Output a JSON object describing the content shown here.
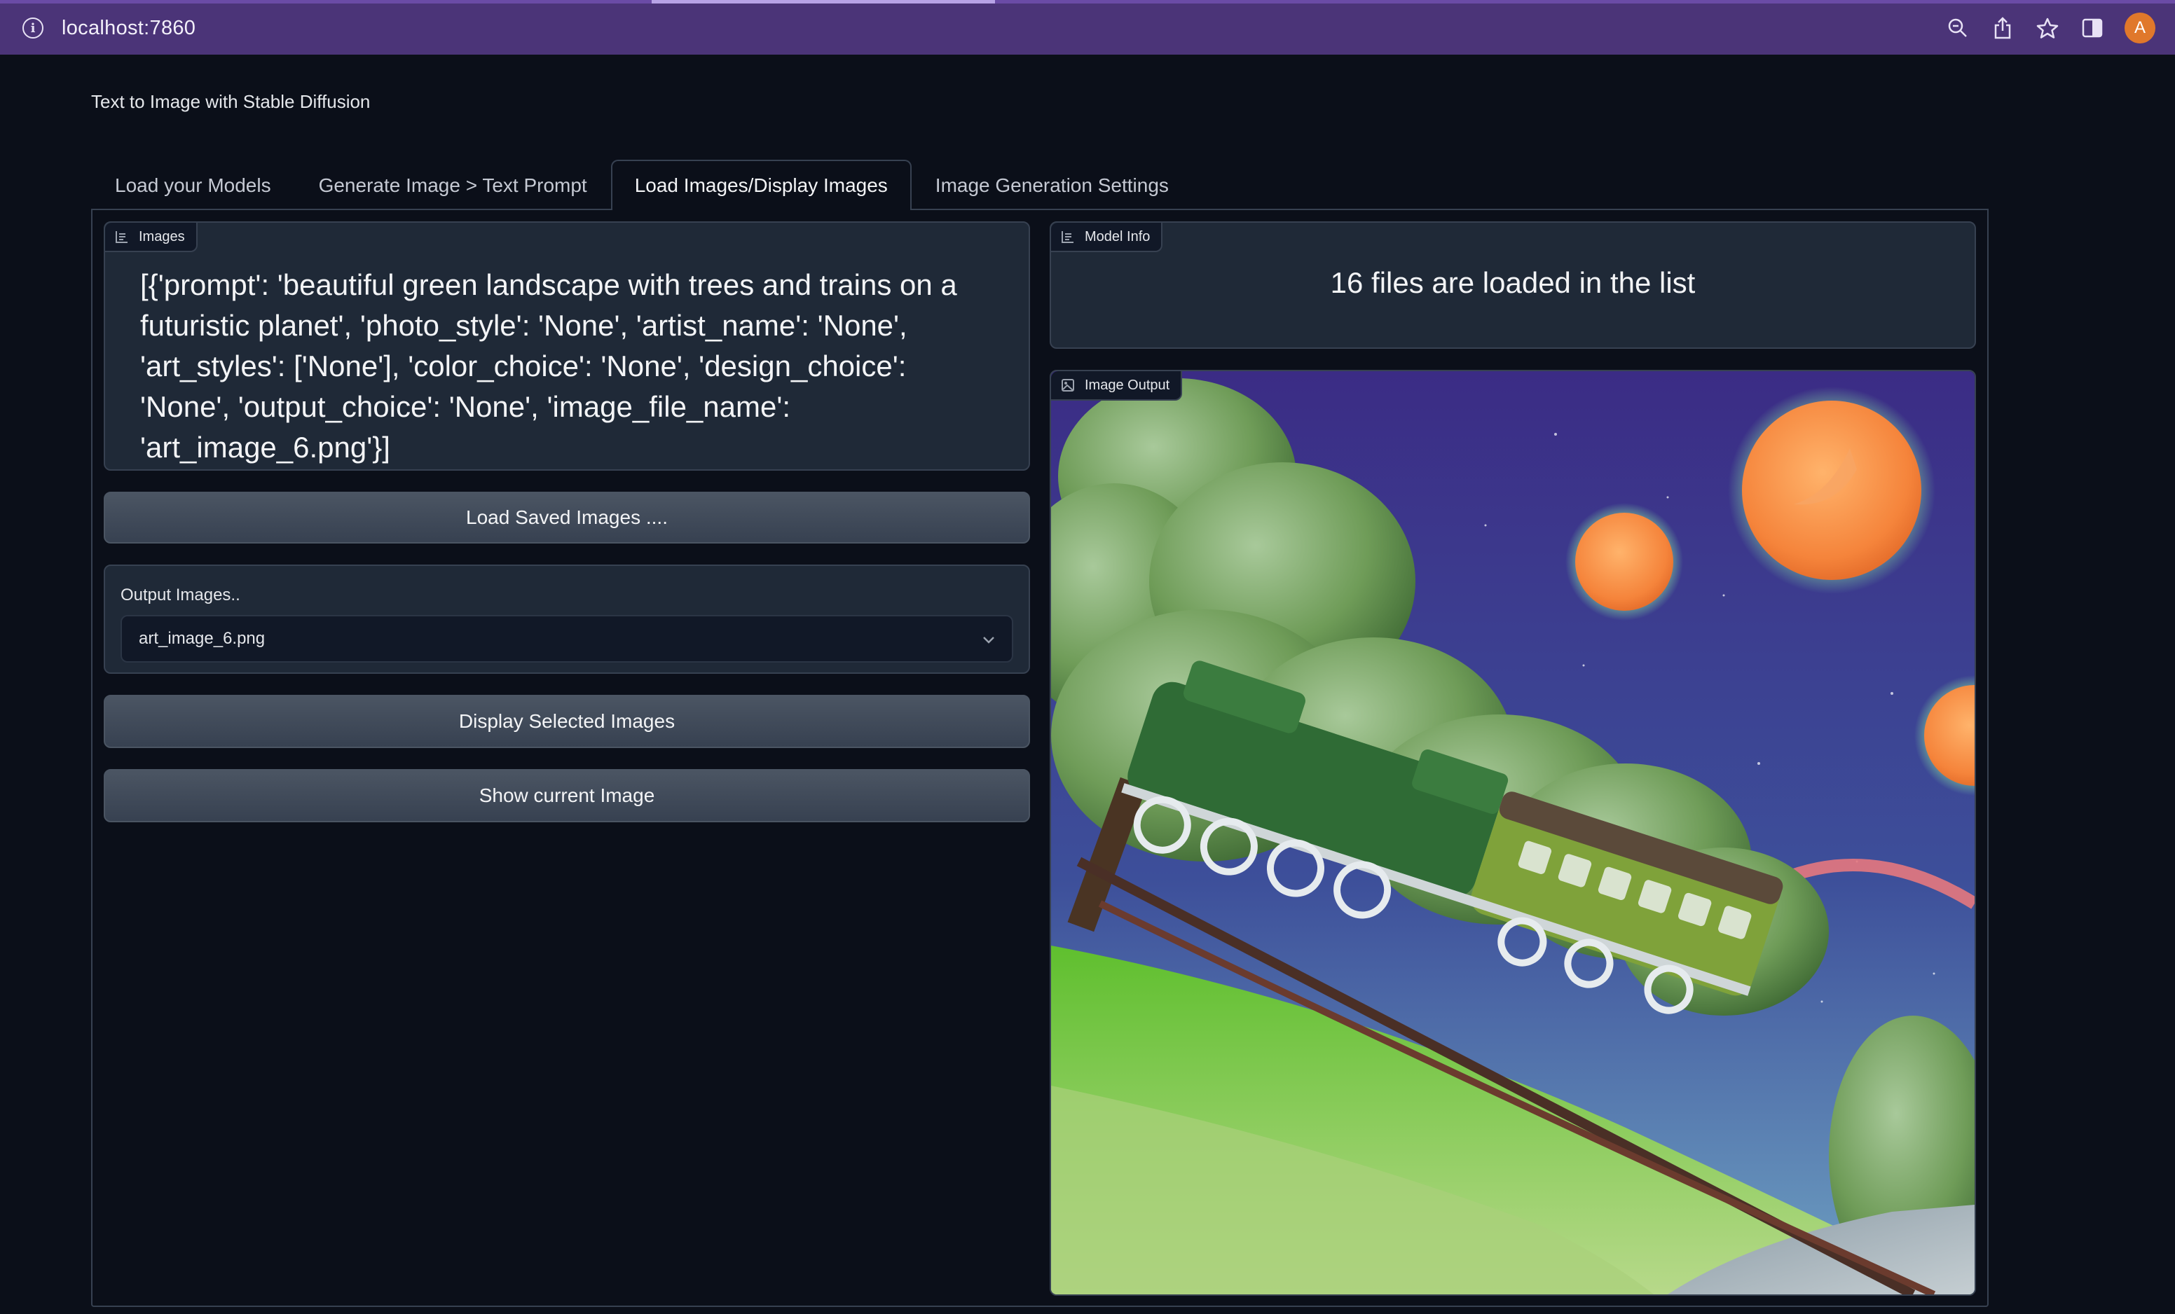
{
  "browser": {
    "url": "localhost:7860",
    "avatar_letter": "A"
  },
  "app": {
    "title": "Text to Image with Stable Diffusion"
  },
  "tabs": [
    {
      "label": "Load your Models",
      "active": false
    },
    {
      "label": "Generate Image > Text Prompt",
      "active": false
    },
    {
      "label": "Load Images/Display Images",
      "active": true
    },
    {
      "label": "Image Generation Settings",
      "active": false
    }
  ],
  "left": {
    "images_block": {
      "label": "Images",
      "text": "[{'prompt': 'beautiful green landscape with trees and trains on a futuristic planet', 'photo_style': 'None', 'artist_name': 'None', 'art_styles': ['None'], 'color_choice': 'None', 'design_choice': 'None', 'output_choice': 'None', 'image_file_name': 'art_image_6.png'}]"
    },
    "load_button": "Load Saved Images ....",
    "dropdown": {
      "label": "Output Images..",
      "selected": "art_image_6.png"
    },
    "display_button": "Display Selected Images",
    "show_button": "Show current Image"
  },
  "right": {
    "model_info": {
      "label": "Model Info",
      "text": "16 files are loaded in the list"
    },
    "image_output": {
      "label": "Image Output"
    }
  },
  "colors": {
    "background": "#0b0f19",
    "block": "#1f2937",
    "border": "#374151",
    "browser_bar": "#4b3478",
    "avatar": "#e0782b"
  }
}
